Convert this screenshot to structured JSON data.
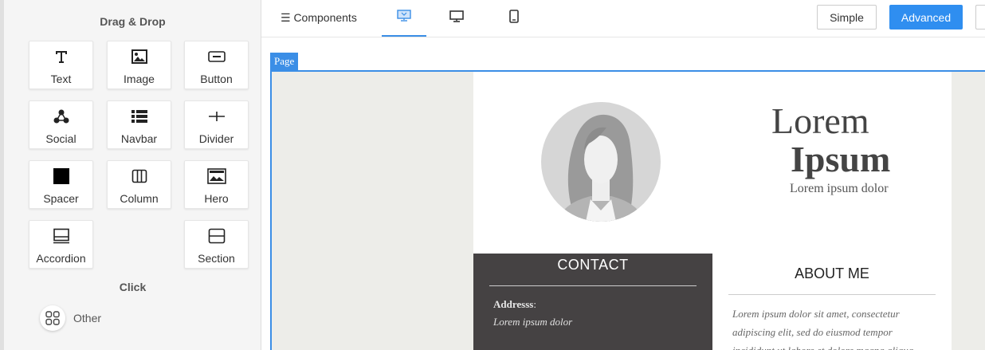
{
  "sidebar": {
    "drag_drop_title": "Drag & Drop",
    "click_title": "Click",
    "blocks": [
      {
        "label": "Text",
        "icon": "text-icon"
      },
      {
        "label": "Image",
        "icon": "image-icon"
      },
      {
        "label": "Button",
        "icon": "button-icon"
      },
      {
        "label": "Social",
        "icon": "social-icon"
      },
      {
        "label": "Navbar",
        "icon": "navbar-icon"
      },
      {
        "label": "Divider",
        "icon": "divider-icon"
      },
      {
        "label": "Spacer",
        "icon": "spacer-icon"
      },
      {
        "label": "Column",
        "icon": "column-icon"
      },
      {
        "label": "Hero",
        "icon": "hero-icon"
      },
      {
        "label": "Accordion",
        "icon": "accordion-icon"
      },
      {
        "label": "Section",
        "icon": "section-icon"
      }
    ],
    "other_label": "Other"
  },
  "toolbar": {
    "components_label": "☰ Components",
    "view_tabs": [
      "preview-desktop-icon",
      "desktop-icon",
      "mobile-icon"
    ],
    "simple_label": "Simple",
    "advanced_label": "Advanced"
  },
  "canvas": {
    "page_tag": "Page",
    "resume": {
      "name_line1": "Lorem",
      "name_line2": "Ipsum",
      "subtitle": "Lorem ipsum dolor",
      "contact_title": "CONTACT",
      "address_label": "Addresss",
      "address_colon": ":",
      "address_value": "Lorem ipsum dolor",
      "about_title": "ABOUT ME",
      "about_text": "Lorem ipsum dolor sit amet, consectetur adipiscing elit, sed do eiusmod tempor incididunt ut labore et dolore magna aliqua"
    }
  },
  "colors": {
    "accent": "#2f8ef0",
    "contact_bg": "#454243",
    "page_bg": "#edede9"
  }
}
